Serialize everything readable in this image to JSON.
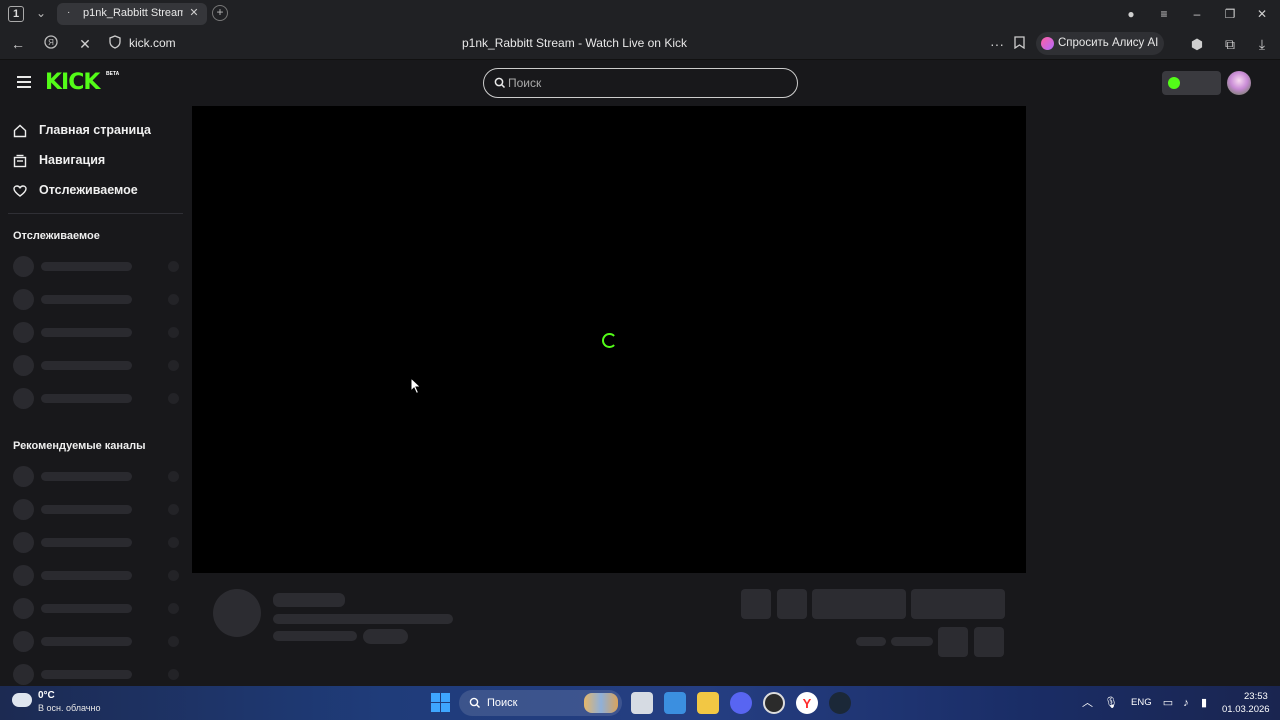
{
  "browser": {
    "tab_count": "1",
    "tab_title": "p1nk_Rabbitt Stream - W",
    "url": "kick.com",
    "page_title": "p1nk_Rabbitt Stream - Watch Live on Kick",
    "alice_label": "Спросить Алису AI"
  },
  "site": {
    "logo_text": "KICK",
    "logo_badge": "BETA",
    "search_placeholder": "Поиск",
    "accent_color": "#53fc18"
  },
  "sidebar": {
    "nav": [
      {
        "label": "Главная страница",
        "icon": "home-icon"
      },
      {
        "label": "Навигация",
        "icon": "browse-icon"
      },
      {
        "label": "Отслеживаемое",
        "icon": "heart-icon"
      }
    ],
    "following_title": "Отслеживаемое",
    "recommended_title": "Рекомендуемые каналы"
  },
  "player": {
    "state": "loading"
  },
  "taskbar": {
    "weather_temp": "0°C",
    "weather_desc": "В осн. облачно",
    "search_label": "Поиск",
    "lang": "ENG",
    "time": "23:53",
    "date": "01.03.2026"
  }
}
